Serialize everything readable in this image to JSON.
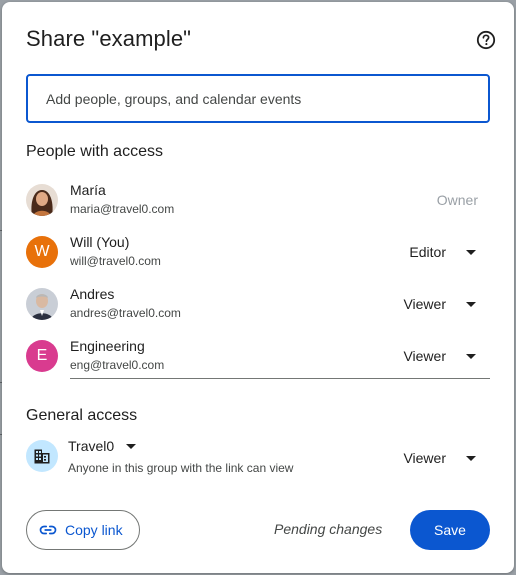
{
  "dialog": {
    "title": "Share \"example\"",
    "help_icon": "help-circle-icon"
  },
  "search": {
    "placeholder": "Add people, groups, and calendar events",
    "value": ""
  },
  "people_section": {
    "heading": "People with access",
    "people": [
      {
        "name": "María",
        "email": "maria@travel0.com",
        "avatar": "photo",
        "role": "Owner",
        "is_owner": true
      },
      {
        "name": "Will (You)",
        "email": "will@travel0.com",
        "avatar": "letter",
        "avatar_letter": "W",
        "avatar_color": "#e8710a",
        "role": "Editor"
      },
      {
        "name": "Andres",
        "email": "andres@travel0.com",
        "avatar": "photo",
        "role": "Viewer"
      },
      {
        "name": "Engineering",
        "email": "eng@travel0.com",
        "avatar": "letter",
        "avatar_letter": "E",
        "avatar_color": "#d93b8f",
        "role": "Viewer"
      }
    ]
  },
  "general_access": {
    "heading": "General access",
    "group_icon": "domain-building-icon",
    "group_name": "Travel0",
    "description": "Anyone in this group with the link can view",
    "role": "Viewer"
  },
  "footer": {
    "copy_link_label": "Copy link",
    "copy_link_icon": "link-icon",
    "pending_text": "Pending changes",
    "save_label": "Save"
  },
  "colors": {
    "primary": "#0b57d0",
    "group_icon_bg": "#c2e7ff",
    "text": "#1f1f1f",
    "secondary_text": "#444746"
  }
}
